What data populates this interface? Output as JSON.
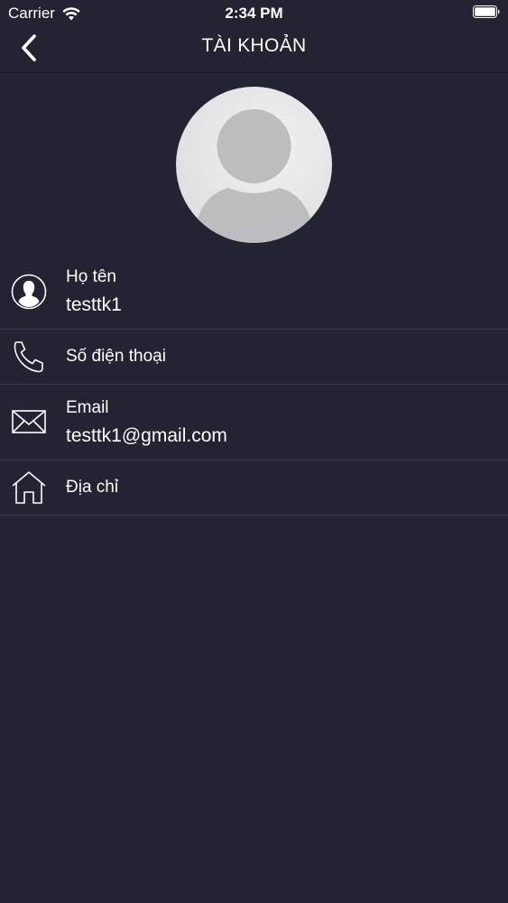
{
  "status_bar": {
    "carrier": "Carrier",
    "time": "2:34 PM",
    "wifi_icon": "wifi-icon",
    "battery_icon": "battery-icon"
  },
  "nav": {
    "title": "TÀI KHOẢN",
    "back_icon": "chevron-left-icon"
  },
  "avatar": {
    "icon": "user-placeholder-icon"
  },
  "profile": {
    "name": {
      "label": "Họ tên",
      "value": "testtk1",
      "icon": "person-icon"
    },
    "phone": {
      "label": "Số điện thoại",
      "value": "",
      "icon": "phone-icon"
    },
    "email": {
      "label": "Email",
      "value": "testtk1@gmail.com",
      "icon": "mail-icon"
    },
    "address": {
      "label": "Địa chỉ",
      "value": "",
      "icon": "home-icon"
    }
  },
  "colors": {
    "background": "#232333",
    "divider": "#3a3a4a",
    "text": "#ffffff"
  }
}
